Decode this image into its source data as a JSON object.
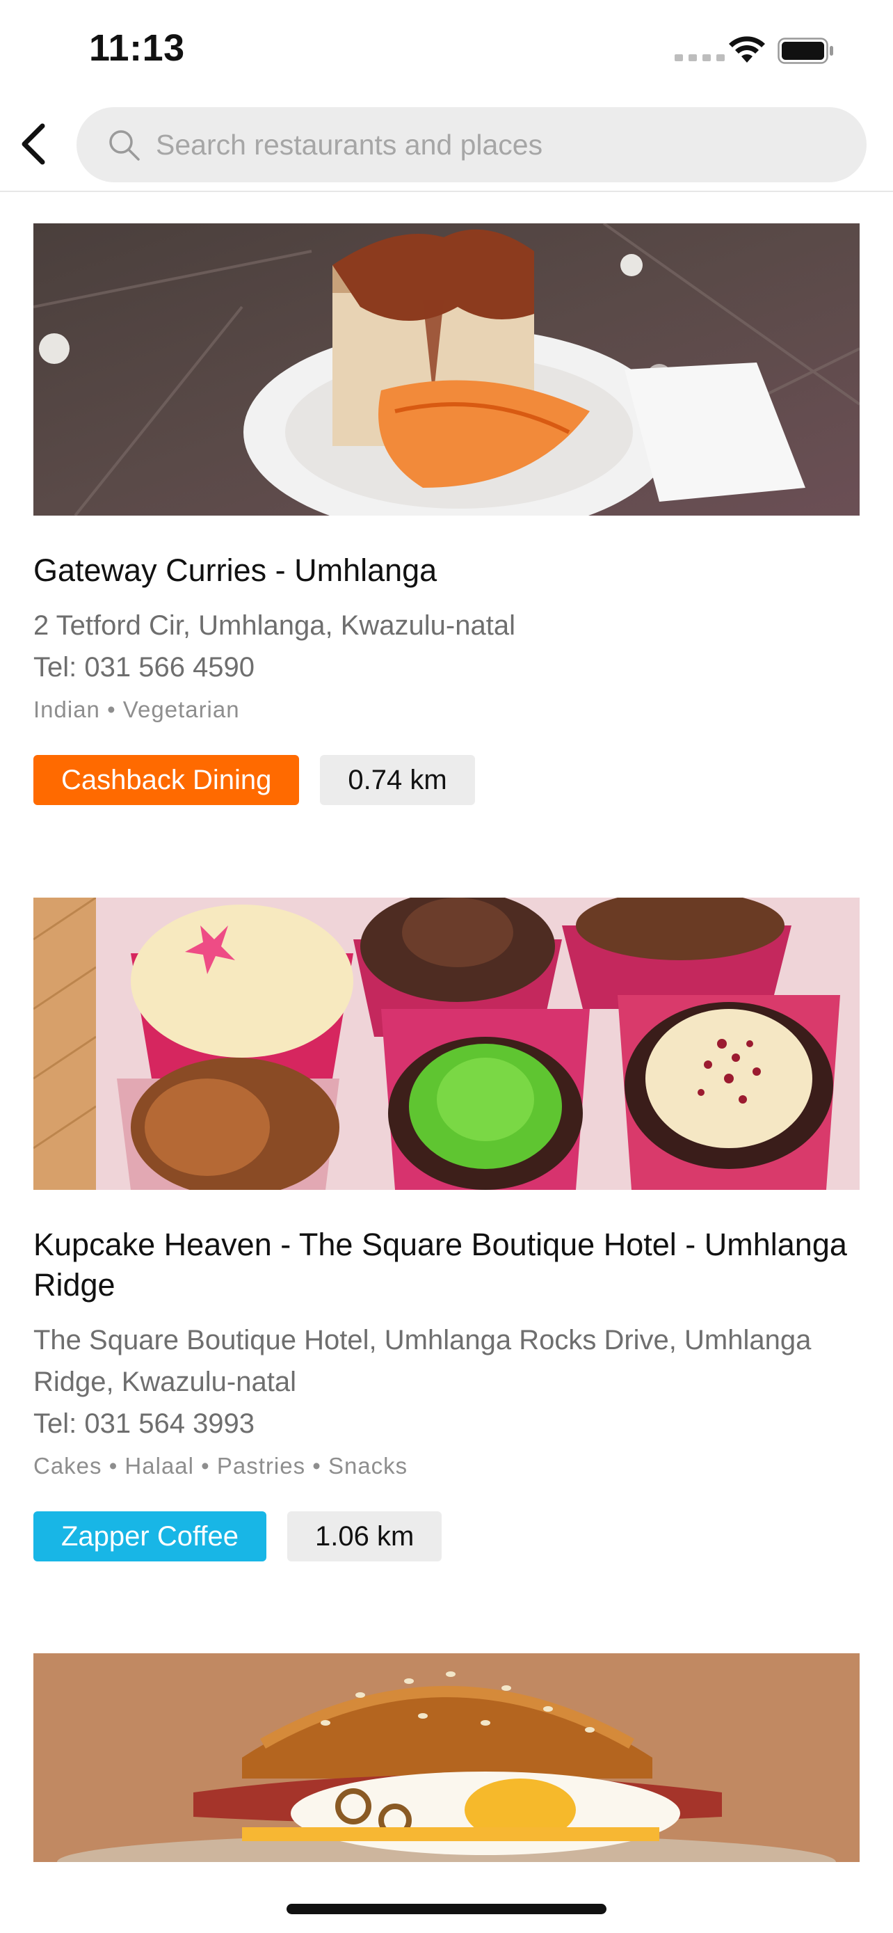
{
  "status_bar": {
    "time": "11:13"
  },
  "header": {
    "search_placeholder": "Search restaurants and places"
  },
  "icons": {
    "back": "chevron-left-icon",
    "search": "magnifier-icon",
    "wifi": "wifi-icon",
    "battery": "battery-icon"
  },
  "colors": {
    "cashback": "#ff6a00",
    "coffee": "#18b6e6"
  },
  "restaurants": [
    {
      "name": "Gateway Curries - Umhlanga",
      "address": "2 Tetford Cir, Umhlanga, Kwazulu-natal",
      "phone": "Tel: 031 566 4590",
      "tags": "Indian • Vegetarian",
      "promo": "Cashback Dining",
      "distance": "0.74 km"
    },
    {
      "name": "Kupcake Heaven - The Square Boutique Hotel - Umhlanga Ridge",
      "address": "The Square Boutique Hotel, Umhlanga Rocks Drive, Umhlanga Ridge, Kwazulu-natal",
      "phone": "Tel: 031 564 3993",
      "tags": "Cakes • Halaal • Pastries • Snacks",
      "promo": "Zapper Coffee",
      "distance": "1.06 km"
    }
  ]
}
